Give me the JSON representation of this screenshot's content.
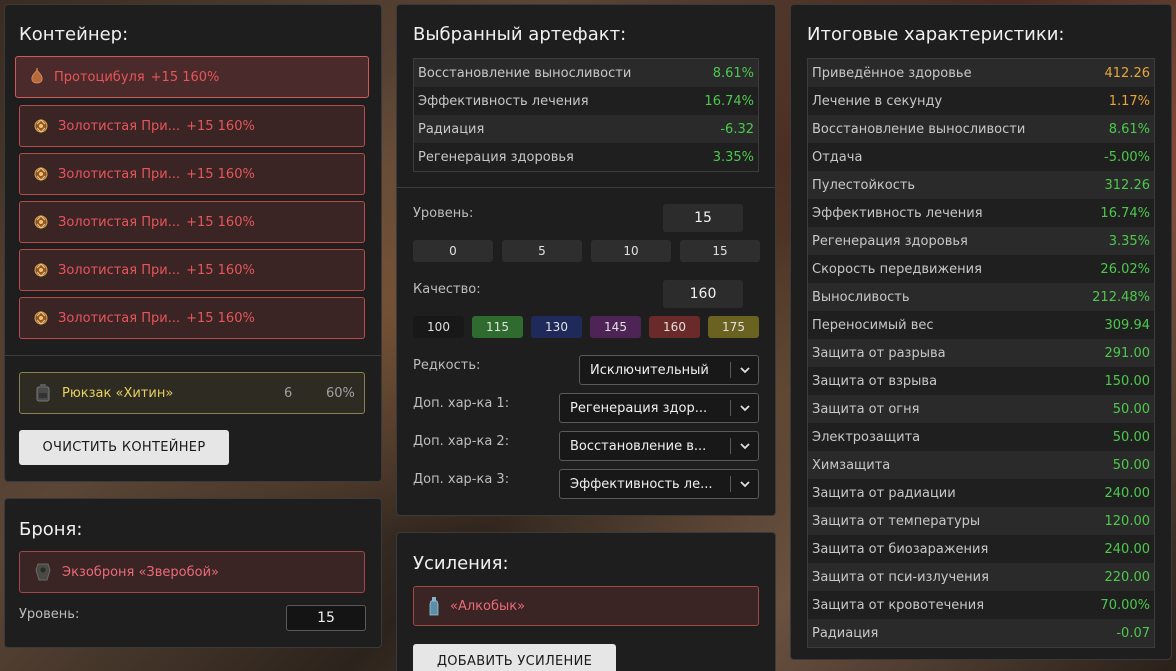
{
  "container": {
    "title": "Контейнер:",
    "items": [
      {
        "name": "Протоцибуля",
        "quality": "+15 160%",
        "icon": "onion-artifact-icon"
      },
      {
        "name": "Золотистая При...",
        "quality": "+15 160%",
        "icon": "golden-artifact-icon"
      },
      {
        "name": "Золотистая При...",
        "quality": "+15 160%",
        "icon": "golden-artifact-icon"
      },
      {
        "name": "Золотистая При...",
        "quality": "+15 160%",
        "icon": "golden-artifact-icon"
      },
      {
        "name": "Золотистая При...",
        "quality": "+15 160%",
        "icon": "golden-artifact-icon"
      },
      {
        "name": "Золотистая При...",
        "quality": "+15 160%",
        "icon": "golden-artifact-icon"
      }
    ],
    "backpack": {
      "name": "Рюкзак «Хитин»",
      "slots": "6",
      "percent": "60%"
    },
    "clear_label": "ОЧИСТИТЬ КОНТЕЙНЕР"
  },
  "armor": {
    "title": "Броня:",
    "name": "Экзоброня «Зверобой»",
    "level_label": "Уровень:",
    "level_value": "15"
  },
  "artifact": {
    "title": "Выбранный артефакт:",
    "stats": [
      {
        "name": "Восстановление выносливости",
        "value": "8.61%",
        "color": "green"
      },
      {
        "name": "Эффективность лечения",
        "value": "16.74%",
        "color": "green"
      },
      {
        "name": "Радиация",
        "value": "-6.32",
        "color": "green"
      },
      {
        "name": "Регенерация здоровья",
        "value": "3.35%",
        "color": "green"
      }
    ],
    "level_label": "Уровень:",
    "level_value": "15",
    "level_presets": [
      "0",
      "5",
      "10",
      "15"
    ],
    "quality_label": "Качество:",
    "quality_value": "160",
    "quality_presets": [
      {
        "label": "100",
        "color": "#181818"
      },
      {
        "label": "115",
        "color": "#2f6b2f"
      },
      {
        "label": "130",
        "color": "#1f2a5a"
      },
      {
        "label": "145",
        "color": "#4e2356"
      },
      {
        "label": "160",
        "color": "#6a2a2a"
      },
      {
        "label": "175",
        "color": "#6a6220"
      }
    ],
    "rarity_label": "Редкость:",
    "rarity_value": "Исключительный",
    "extra1_label": "Доп. хар-ка 1:",
    "extra1_value": "Регенерация здор...",
    "extra2_label": "Доп. хар-ка 2:",
    "extra2_value": "Восстановление в...",
    "extra3_label": "Доп. хар-ка 3:",
    "extra3_value": "Эффективность ле..."
  },
  "boosts": {
    "title": "Усиления:",
    "item": "«Алкобык»",
    "add_label": "ДОБАВИТЬ УСИЛЕНИЕ"
  },
  "totals": {
    "title": "Итоговые характеристики:",
    "stats": [
      {
        "name": "Приведённое здоровье",
        "value": "412.26",
        "color": "orange"
      },
      {
        "name": "Лечение в секунду",
        "value": "1.17%",
        "color": "orange"
      },
      {
        "name": "Восстановление выносливости",
        "value": "8.61%",
        "color": "green"
      },
      {
        "name": "Отдача",
        "value": "-5.00%",
        "color": "green"
      },
      {
        "name": "Пулестойкость",
        "value": "312.26",
        "color": "green"
      },
      {
        "name": "Эффективность лечения",
        "value": "16.74%",
        "color": "green"
      },
      {
        "name": "Регенерация здоровья",
        "value": "3.35%",
        "color": "green"
      },
      {
        "name": "Скорость передвижения",
        "value": "26.02%",
        "color": "green"
      },
      {
        "name": "Выносливость",
        "value": "212.48%",
        "color": "green"
      },
      {
        "name": "Переносимый вес",
        "value": "309.94",
        "color": "green"
      },
      {
        "name": "Защита от разрыва",
        "value": "291.00",
        "color": "green"
      },
      {
        "name": "Защита от взрыва",
        "value": "150.00",
        "color": "green"
      },
      {
        "name": "Защита от огня",
        "value": "50.00",
        "color": "green"
      },
      {
        "name": "Электрозащита",
        "value": "50.00",
        "color": "green"
      },
      {
        "name": "Химзащита",
        "value": "50.00",
        "color": "green"
      },
      {
        "name": "Защита от радиации",
        "value": "240.00",
        "color": "green"
      },
      {
        "name": "Защита от температуры",
        "value": "120.00",
        "color": "green"
      },
      {
        "name": "Защита от биозаражения",
        "value": "240.00",
        "color": "green"
      },
      {
        "name": "Защита от пси-излучения",
        "value": "220.00",
        "color": "green"
      },
      {
        "name": "Защита от кровотечения",
        "value": "70.00%",
        "color": "green"
      },
      {
        "name": "Радиация",
        "value": "-0.07",
        "color": "green"
      }
    ]
  }
}
